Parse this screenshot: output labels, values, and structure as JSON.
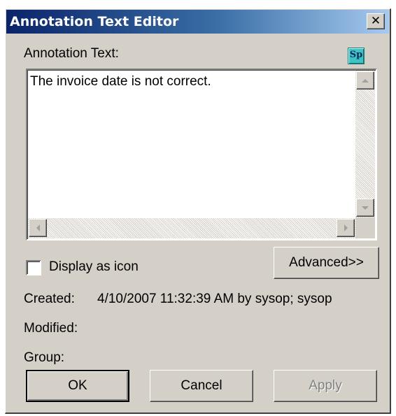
{
  "window": {
    "title": "Annotation Text Editor",
    "close_icon": "close-icon",
    "close_glyph": "✕"
  },
  "annotation": {
    "label": "Annotation Text:",
    "spell_check_icon": "spell-check-icon",
    "spell_check_glyph": "Sp",
    "text": "The invoice date is not correct."
  },
  "options": {
    "display_as_icon_label": "Display as icon",
    "display_as_icon_checked": false,
    "advanced_label": "Advanced>>"
  },
  "info": {
    "created_label": "Created:",
    "created_value": "4/10/2007 11:32:39 AM by sysop; sysop",
    "modified_label": "Modified:",
    "modified_value": "",
    "group_label": "Group:",
    "group_value": ""
  },
  "buttons": {
    "ok": "OK",
    "cancel": "Cancel",
    "apply": "Apply",
    "apply_enabled": false
  },
  "colors": {
    "titlebar_start": "#0a246a",
    "titlebar_end": "#a6caf0",
    "dialog_face": "#d4d0c8",
    "spell_icon": "#3fc4c4"
  }
}
